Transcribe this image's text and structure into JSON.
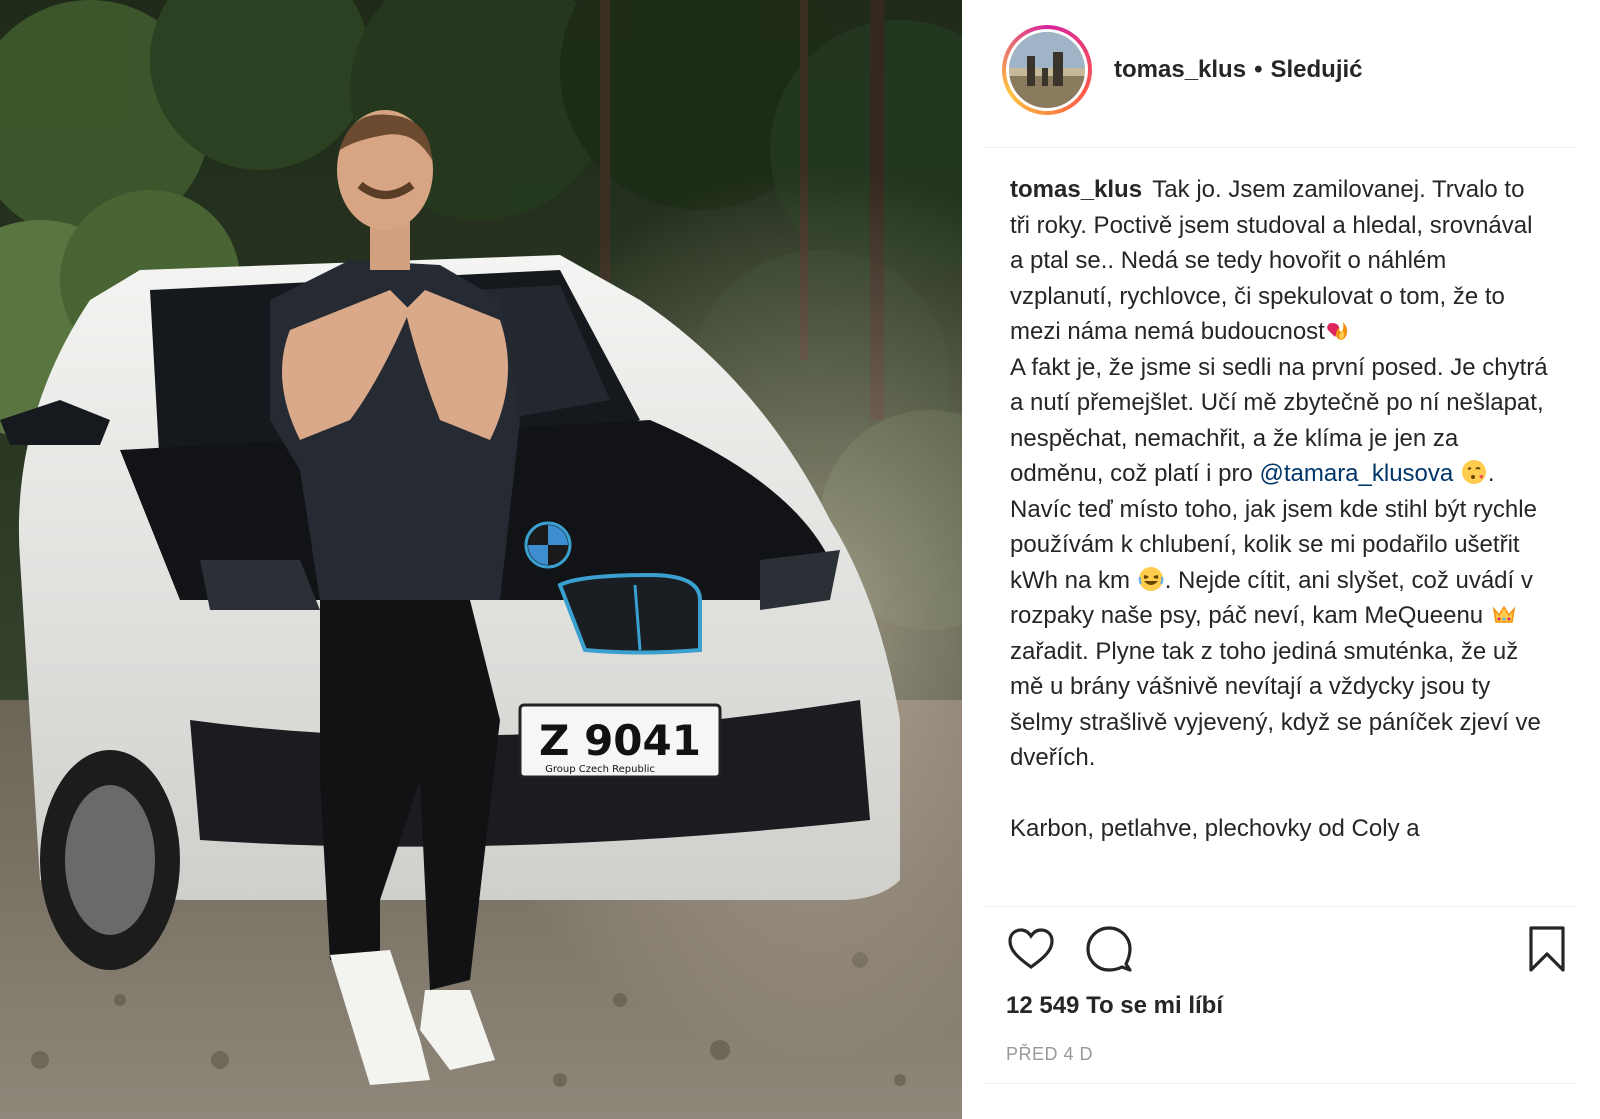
{
  "post": {
    "username": "tomas_klus",
    "separator": "•",
    "follow_label": "Sledujić",
    "caption_parts": {
      "p1": "Tak jo. Jsem zamilovanej. Trvalo to tři roky. Poctivě jsem studoval a hledal, srovnával a ptal se.. Nedá se tedy hovořit o náhlém vzplanutí, rychlovce, či spekulovat o tom, že to mezi náma nemá budoucnost",
      "p2": "A fakt je, že jsme si sedli na první posed. Je chytrá a nutí přemejšlet. Učí mě zbytečně po ní nešlapat, nespěchat, nemachřit, a že klíma je jen za odměnu, což platí i pro ",
      "mention": "@tamara_klusova",
      "p3": ". Navíc teď místo toho, jak jsem kde stihl být rychle používám k chlubení, kolik se mi podařilo ušetřit kWh na km ",
      "p4": ". Nejde cítit, ani slyšet, což uvádí v rozpaky naše psy, páč neví, kam MeQueenu ",
      "p5": " zařadit. Plyne tak z toho jediná smuténka, že už mě u brány vášnivě nevítají a vždycky jsou ty šelmy strašlivě vyjevený, když se páníček zjeví ve dveřích.",
      "p6": "Karbon, petlahve, plechovky od Coly a"
    },
    "likes_text": "12 549 To se mi líbí",
    "timestamp": "PŘED 4 D",
    "plate_text": "Z 9041",
    "plate_subtext": "Group Czech Republic"
  },
  "icons": {
    "like": "heart-icon",
    "comment": "comment-icon",
    "save": "bookmark-icon",
    "emojis": [
      "heart-fire-emoji",
      "kiss-emoji",
      "laughing-emoji",
      "crown-emoji"
    ]
  },
  "colors": {
    "mention": "#003569",
    "text": "#262626",
    "muted": "#999999",
    "divider": "#efefef"
  }
}
